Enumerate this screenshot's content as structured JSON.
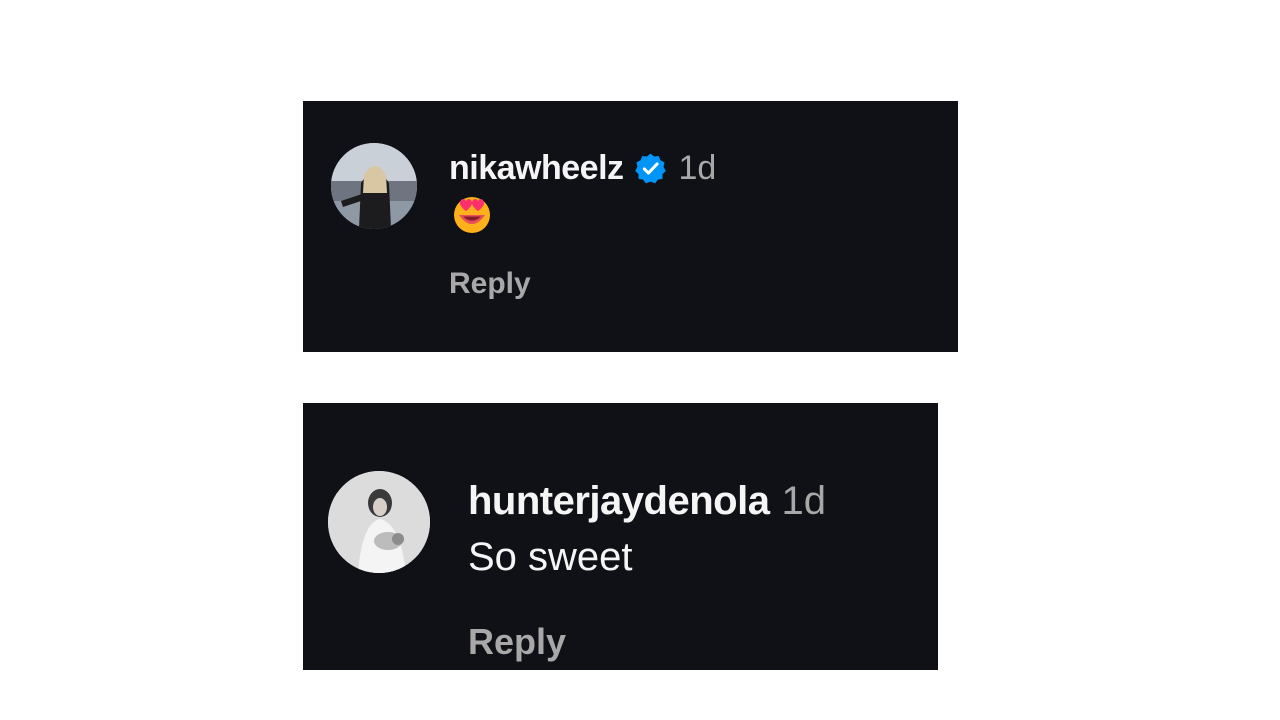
{
  "comments": [
    {
      "username": "nikawheelz",
      "verified": true,
      "timestamp": "1d",
      "text": "",
      "emoji": "heart-eyes-emoji",
      "reply_label": "Reply"
    },
    {
      "username": "hunterjaydenola",
      "verified": false,
      "timestamp": "1d",
      "text": "So sweet",
      "reply_label": "Reply"
    }
  ],
  "colors": {
    "card_bg": "#0f1117",
    "username": "#f5f5f5",
    "muted": "#a8a8a8",
    "verified_blue": "#0095f6"
  }
}
